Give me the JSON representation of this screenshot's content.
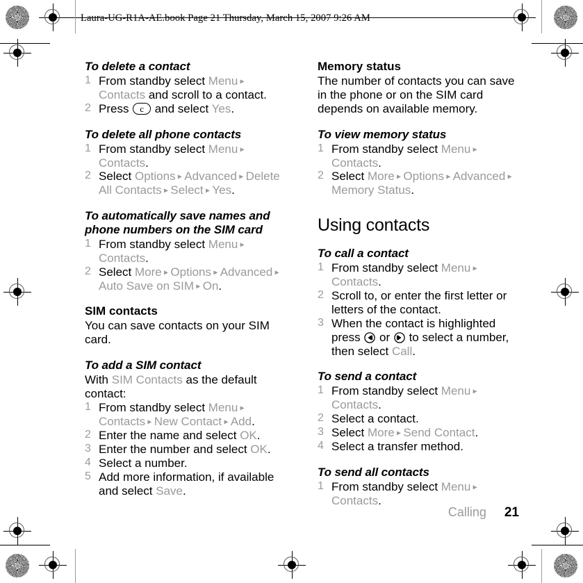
{
  "header": {
    "slug": "Laura-UG-R1A-AE.book  Page 21  Thursday, March 15, 2007  9:26 AM"
  },
  "footer": {
    "chapter": "Calling",
    "page_number": "21"
  },
  "left_column": {
    "sections": [
      {
        "heading": "To delete a contact",
        "heading_style": "bold-italic",
        "steps": [
          [
            {
              "t": "From standby select ",
              "s": "plain"
            },
            {
              "t": "Menu",
              "s": "menu"
            },
            {
              "t": " ▸ ",
              "s": "arrow"
            },
            {
              "t": "Contacts",
              "s": "menu"
            },
            {
              "t": " and scroll to a contact.",
              "s": "plain"
            }
          ],
          [
            {
              "t": "Press ",
              "s": "plain"
            },
            {
              "t": "c",
              "s": "key"
            },
            {
              "t": " and select ",
              "s": "plain"
            },
            {
              "t": "Yes",
              "s": "menu"
            },
            {
              "t": ".",
              "s": "plain"
            }
          ]
        ]
      },
      {
        "heading": "To delete all phone contacts",
        "heading_style": "bold-italic",
        "steps": [
          [
            {
              "t": "From standby select ",
              "s": "plain"
            },
            {
              "t": "Menu",
              "s": "menu"
            },
            {
              "t": " ▸ ",
              "s": "arrow"
            },
            {
              "t": "Contacts",
              "s": "menu"
            },
            {
              "t": ".",
              "s": "plain"
            }
          ],
          [
            {
              "t": "Select ",
              "s": "plain"
            },
            {
              "t": "Options",
              "s": "menu"
            },
            {
              "t": " ▸ ",
              "s": "arrow"
            },
            {
              "t": "Advanced",
              "s": "menu"
            },
            {
              "t": " ▸ ",
              "s": "arrow"
            },
            {
              "t": "Delete All Contacts",
              "s": "menu"
            },
            {
              "t": " ▸ ",
              "s": "arrow"
            },
            {
              "t": "Select",
              "s": "menu"
            },
            {
              "t": " ▸ ",
              "s": "arrow"
            },
            {
              "t": "Yes",
              "s": "menu"
            },
            {
              "t": ".",
              "s": "plain"
            }
          ]
        ]
      },
      {
        "heading": "To automatically save names and phone numbers on the SIM card",
        "heading_style": "bold-italic",
        "steps": [
          [
            {
              "t": "From standby select ",
              "s": "plain"
            },
            {
              "t": "Menu",
              "s": "menu"
            },
            {
              "t": " ▸ ",
              "s": "arrow"
            },
            {
              "t": "Contacts",
              "s": "menu"
            },
            {
              "t": ".",
              "s": "plain"
            }
          ],
          [
            {
              "t": "Select ",
              "s": "plain"
            },
            {
              "t": "More",
              "s": "menu"
            },
            {
              "t": " ▸ ",
              "s": "arrow"
            },
            {
              "t": "Options",
              "s": "menu"
            },
            {
              "t": " ▸ ",
              "s": "arrow"
            },
            {
              "t": "Advanced",
              "s": "menu"
            },
            {
              "t": " ▸ ",
              "s": "arrow"
            },
            {
              "t": "Auto Save on SIM",
              "s": "menu"
            },
            {
              "t": " ▸ ",
              "s": "arrow"
            },
            {
              "t": "On",
              "s": "menu"
            },
            {
              "t": ".",
              "s": "plain"
            }
          ]
        ]
      },
      {
        "heading": "SIM contacts",
        "heading_style": "bold",
        "body": "You can save contacts on your SIM card.",
        "steps": []
      },
      {
        "heading": "To add a SIM contact",
        "heading_style": "bold-italic",
        "intro": [
          {
            "t": "With ",
            "s": "plain"
          },
          {
            "t": "SIM Contacts",
            "s": "menu"
          },
          {
            "t": " as the default contact:",
            "s": "plain"
          }
        ],
        "steps": [
          [
            {
              "t": "From standby select ",
              "s": "plain"
            },
            {
              "t": "Menu",
              "s": "menu"
            },
            {
              "t": " ▸ ",
              "s": "arrow"
            },
            {
              "t": "Contacts",
              "s": "menu"
            },
            {
              "t": " ▸ ",
              "s": "arrow"
            },
            {
              "t": "New Contact",
              "s": "menu"
            },
            {
              "t": " ▸ ",
              "s": "arrow"
            },
            {
              "t": "Add",
              "s": "menu"
            },
            {
              "t": ".",
              "s": "plain"
            }
          ],
          [
            {
              "t": "Enter the name and select ",
              "s": "plain"
            },
            {
              "t": "OK",
              "s": "menu"
            },
            {
              "t": ".",
              "s": "plain"
            }
          ],
          [
            {
              "t": "Enter the number and select ",
              "s": "plain"
            },
            {
              "t": "OK",
              "s": "menu"
            },
            {
              "t": ".",
              "s": "plain"
            }
          ],
          [
            {
              "t": "Select a number.",
              "s": "plain"
            }
          ],
          [
            {
              "t": "Add more information, if available and select ",
              "s": "plain"
            },
            {
              "t": "Save",
              "s": "menu"
            },
            {
              "t": ".",
              "s": "plain"
            }
          ]
        ]
      }
    ]
  },
  "right_column": {
    "sections": [
      {
        "heading": "Memory status",
        "heading_style": "bold",
        "body": "The number of contacts you can save in the phone or on the SIM card depends on available memory.",
        "steps": []
      },
      {
        "heading": "To view memory status",
        "heading_style": "bold-italic",
        "steps": [
          [
            {
              "t": "From standby select ",
              "s": "plain"
            },
            {
              "t": "Menu",
              "s": "menu"
            },
            {
              "t": " ▸ ",
              "s": "arrow"
            },
            {
              "t": "Contacts",
              "s": "menu"
            },
            {
              "t": ".",
              "s": "plain"
            }
          ],
          [
            {
              "t": "Select ",
              "s": "plain"
            },
            {
              "t": "More",
              "s": "menu"
            },
            {
              "t": " ▸ ",
              "s": "arrow"
            },
            {
              "t": "Options",
              "s": "menu"
            },
            {
              "t": " ▸ ",
              "s": "arrow"
            },
            {
              "t": "Advanced",
              "s": "menu"
            },
            {
              "t": " ▸ ",
              "s": "arrow"
            },
            {
              "t": "Memory Status",
              "s": "menu"
            },
            {
              "t": ".",
              "s": "plain"
            }
          ]
        ]
      },
      {
        "heading": "Using contacts",
        "heading_style": "h1",
        "steps": []
      },
      {
        "heading": "To call a contact",
        "heading_style": "bold-italic",
        "steps": [
          [
            {
              "t": "From standby select ",
              "s": "plain"
            },
            {
              "t": "Menu",
              "s": "menu"
            },
            {
              "t": " ▸ ",
              "s": "arrow"
            },
            {
              "t": "Contacts",
              "s": "menu"
            },
            {
              "t": ".",
              "s": "plain"
            }
          ],
          [
            {
              "t": "Scroll to, or enter the first letter or letters of the contact.",
              "s": "plain"
            }
          ],
          [
            {
              "t": "When the contact is highlighted press ",
              "s": "plain"
            },
            {
              "t": "nav-left",
              "s": "navkey"
            },
            {
              "t": " or ",
              "s": "plain"
            },
            {
              "t": "nav-right",
              "s": "navkey"
            },
            {
              "t": " to select a number, then select ",
              "s": "plain"
            },
            {
              "t": "Call",
              "s": "menu"
            },
            {
              "t": ".",
              "s": "plain"
            }
          ]
        ]
      },
      {
        "heading": "To send a contact",
        "heading_style": "bold-italic",
        "steps": [
          [
            {
              "t": "From standby select ",
              "s": "plain"
            },
            {
              "t": "Menu",
              "s": "menu"
            },
            {
              "t": " ▸ ",
              "s": "arrow"
            },
            {
              "t": "Contacts",
              "s": "menu"
            },
            {
              "t": ".",
              "s": "plain"
            }
          ],
          [
            {
              "t": "Select a contact.",
              "s": "plain"
            }
          ],
          [
            {
              "t": "Select ",
              "s": "plain"
            },
            {
              "t": "More",
              "s": "menu"
            },
            {
              "t": " ▸ ",
              "s": "arrow"
            },
            {
              "t": "Send Contact",
              "s": "menu"
            },
            {
              "t": ".",
              "s": "plain"
            }
          ],
          [
            {
              "t": "Select a transfer method.",
              "s": "plain"
            }
          ]
        ]
      },
      {
        "heading": "To send all contacts",
        "heading_style": "bold-italic",
        "steps": [
          [
            {
              "t": "From standby select ",
              "s": "plain"
            },
            {
              "t": "Menu",
              "s": "menu"
            },
            {
              "t": " ▸ ",
              "s": "arrow"
            },
            {
              "t": "Contacts",
              "s": "menu"
            },
            {
              "t": ".",
              "s": "plain"
            }
          ]
        ]
      }
    ]
  },
  "print_marks": {
    "registration_target": "registration-target-icon",
    "color_patch": "starburst-color-patch-icon"
  },
  "colors": {
    "menu_grey": "#9a9a9a",
    "text_black": "#000000",
    "page_background": "#ffffff"
  }
}
